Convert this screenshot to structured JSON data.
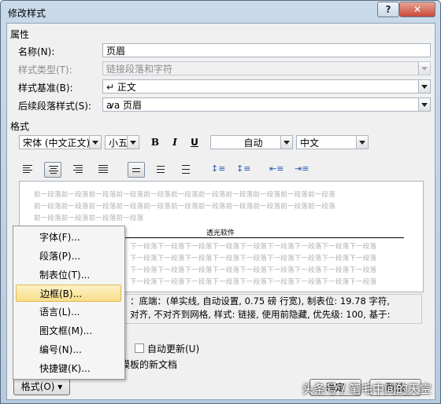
{
  "window": {
    "title": "修改样式"
  },
  "titlebar": {
    "help_label": "?",
    "close_label": "✕"
  },
  "properties": {
    "section_label": "属性",
    "name_label": "名称(N):",
    "name_value": "页眉",
    "style_type_label": "样式类型(T):",
    "style_type_value": "链接段落和字符",
    "based_on_label": "样式基准(B):",
    "based_on_value": "↵ 正文",
    "next_style_label": "后续段落样式(S):",
    "next_style_value": "ꜹa 页眉"
  },
  "format": {
    "section_label": "格式",
    "font_value": "宋体 (中文正文)",
    "size_value": "小五",
    "bold_label": "B",
    "italic_label": "I",
    "underline_label": "U",
    "color_value": "自动",
    "lang_value": "中文"
  },
  "preview": {
    "prev_lines": [
      "前一段落前一段落前一段落前一段落前一段落前一段落前一段落前一段落前一段落前一段落前一段落",
      "前一段落前一段落前一段落前一段落前一段落前一段落前一段落前一段落前一段落前一段落前一段落",
      "前一段落前一段落前一段落前一段落"
    ],
    "sample_text": "透光软件",
    "next_lines": [
      "下一段落下一段落下一段落下一段落下一段落下一段落下一段落下一段落下一段落",
      "下一段落下一段落下一段落下一段落下一段落下一段落下一段落下一段落下一段落",
      "下一段落下一段落下一段落下一段落下一段落下一段落下一段落下一段落下一段落",
      "下一段落下一段落下一段落下一段落下一段落下一段落下一段落下一段落下一段落"
    ]
  },
  "description": {
    "line1": "：底端：(单实线, 自动设置, 0.75 磅 行宽), 制表位: 19.78 字符,",
    "line2": "对齐, 不对齐到网格, 样式: 链接, 使用前隐藏, 优先级: 100, 基于:"
  },
  "options": {
    "auto_update_label": "自动更新(U)",
    "new_doc_label": "模板的新文档"
  },
  "menu": {
    "items": [
      "字体(F)...",
      "段落(P)...",
      "制表位(T)...",
      "边框(B)...",
      "语言(L)...",
      "图文框(M)...",
      "编号(N)...",
      "快捷键(K)..."
    ]
  },
  "buttons": {
    "format_label": "格式(O) ▾",
    "ok_label": "确定",
    "cancel_label": "取消"
  },
  "watermark": "头条号 / 笔毛中间的天空"
}
